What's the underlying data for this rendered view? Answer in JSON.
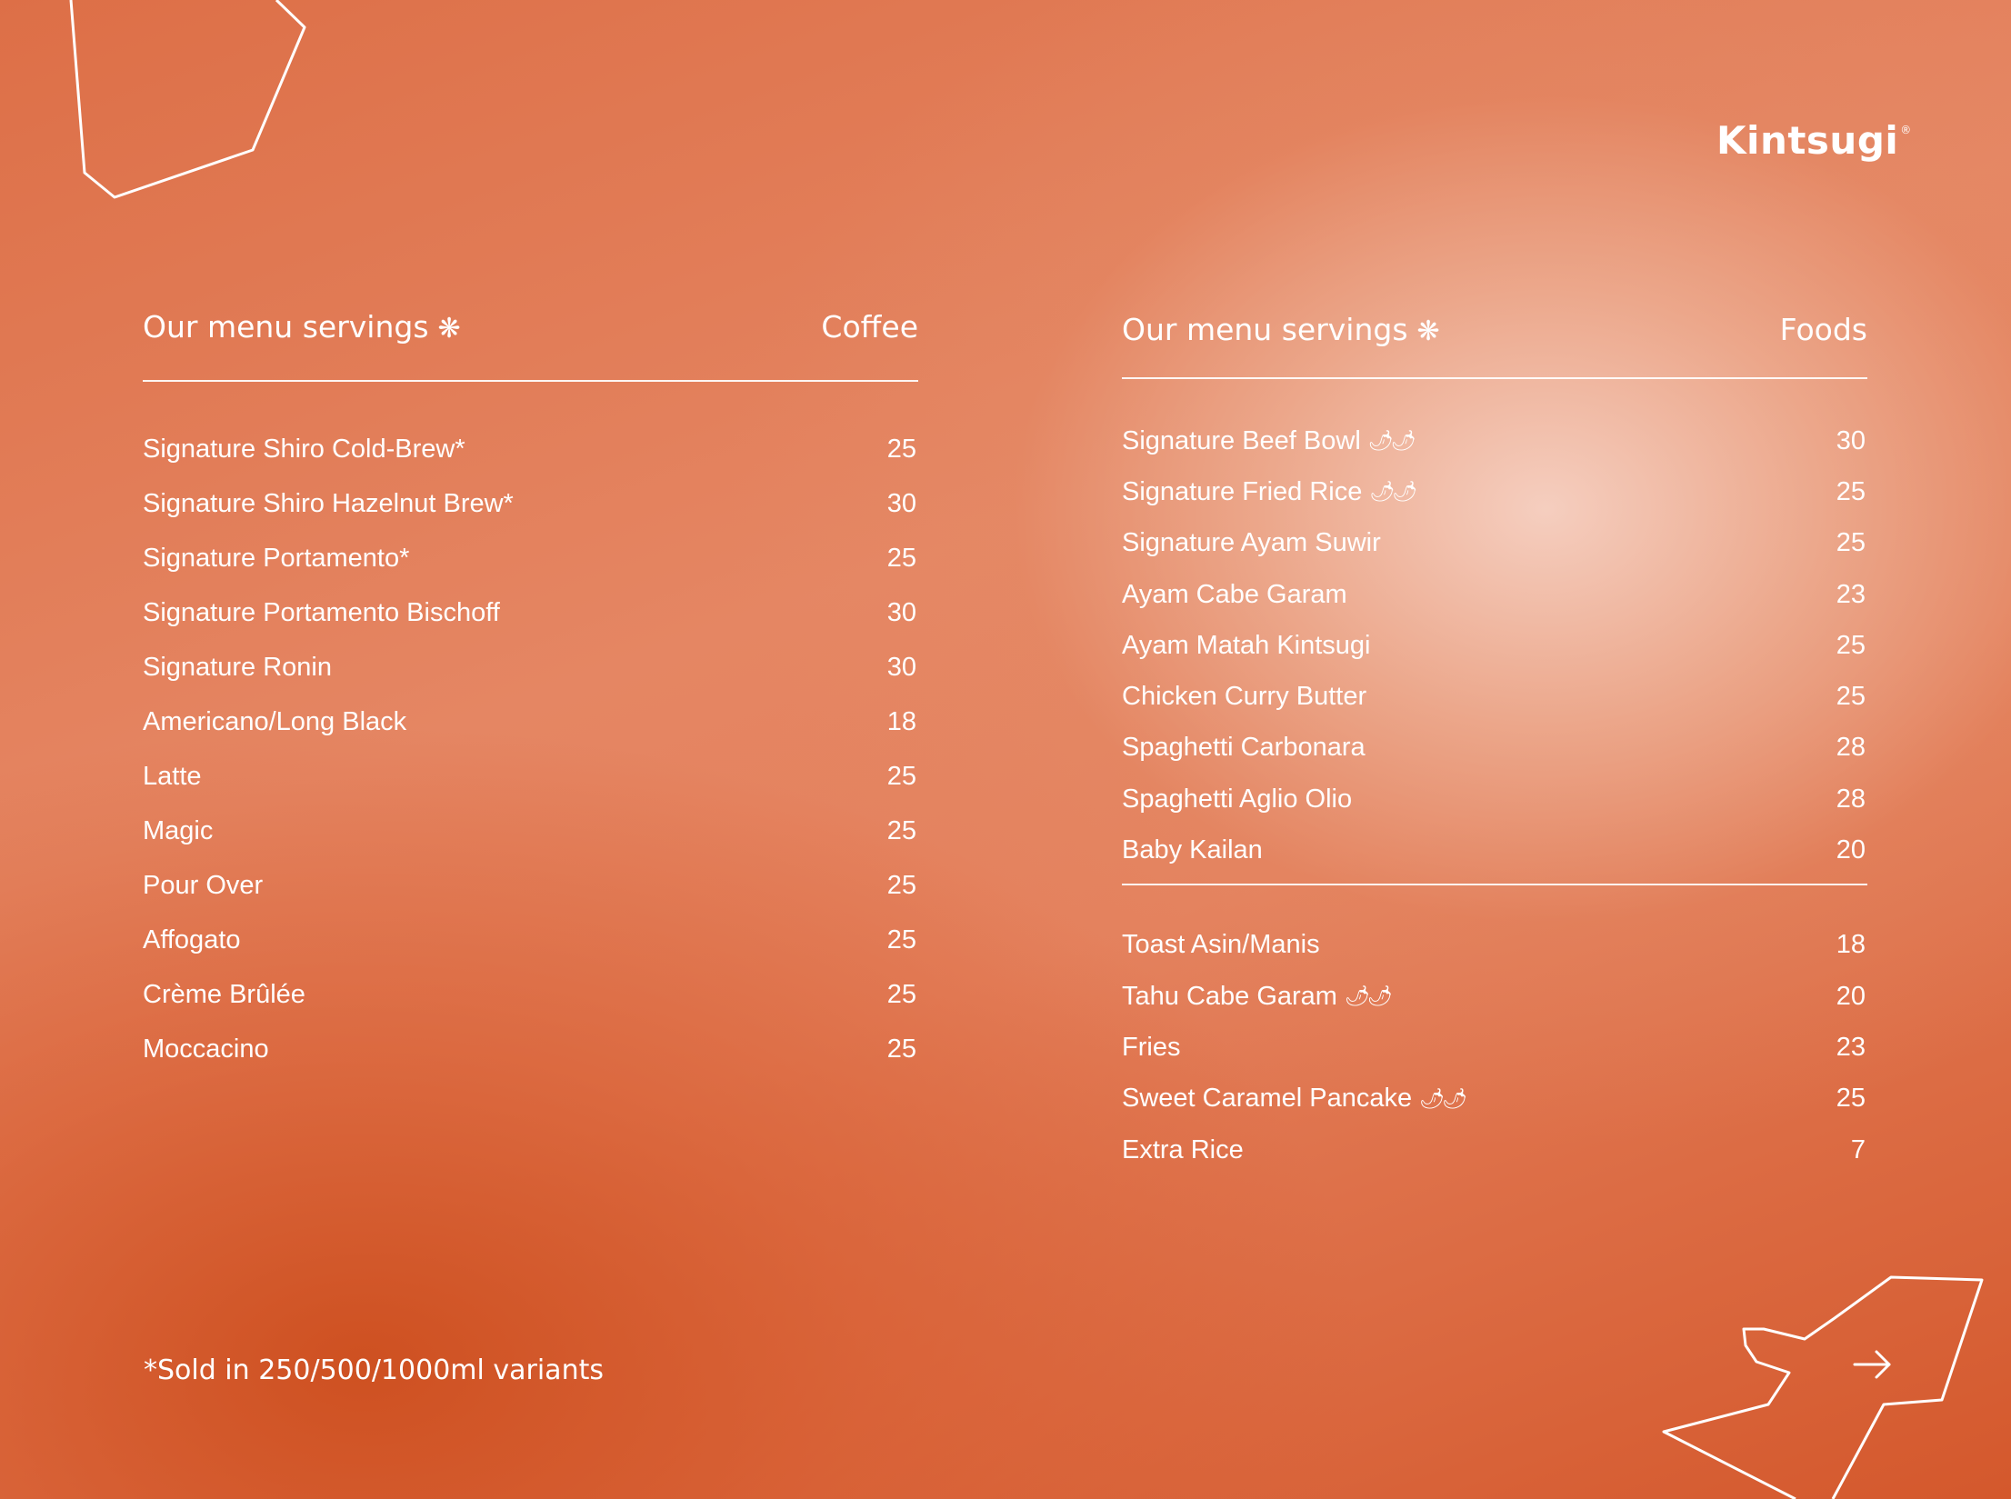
{
  "brand": {
    "logo_text": "Kintsugi",
    "mark": "®"
  },
  "coffee": {
    "heading": "Our menu servings",
    "heading_icon": "❋",
    "category": "Coffee",
    "items": [
      {
        "name": "Signature Shiro Cold-Brew*",
        "price": "25"
      },
      {
        "name": "Signature Shiro Hazelnut Brew*",
        "price": "30"
      },
      {
        "name": "Signature Portamento*",
        "price": "25"
      },
      {
        "name": "Signature Portamento Bischoff",
        "price": "30"
      },
      {
        "name": "Signature Ronin",
        "price": "30"
      },
      {
        "name": "Americano/Long Black",
        "price": "18"
      },
      {
        "name": "Latte",
        "price": "25"
      },
      {
        "name": "Magic",
        "price": "25"
      },
      {
        "name": "Pour Over",
        "price": "25"
      },
      {
        "name": "Affogato",
        "price": "25"
      },
      {
        "name": "Crème Brûlée",
        "price": "25"
      },
      {
        "name": "Moccacino",
        "price": "25"
      }
    ]
  },
  "foods": {
    "heading": "Our menu servings",
    "heading_icon": "❋",
    "category": "Foods",
    "mains": [
      {
        "name": "Signature Beef Bowl",
        "price": "30",
        "spicy": true
      },
      {
        "name": "Signature Fried Rice",
        "price": "25",
        "spicy": true
      },
      {
        "name": "Signature Ayam Suwir",
        "price": "25",
        "spicy": false
      },
      {
        "name": "Ayam Cabe Garam",
        "price": "23",
        "spicy": false
      },
      {
        "name": "Ayam Matah Kintsugi",
        "price": "25",
        "spicy": false
      },
      {
        "name": "Chicken Curry Butter",
        "price": "25",
        "spicy": false
      },
      {
        "name": "Spaghetti Carbonara",
        "price": "28",
        "spicy": false
      },
      {
        "name": "Spaghetti Aglio Olio",
        "price": "28",
        "spicy": false
      },
      {
        "name": "Baby Kailan",
        "price": "20",
        "spicy": false
      }
    ],
    "sides": [
      {
        "name": "Toast  Asin/Manis",
        "price": "18",
        "spicy": false
      },
      {
        "name": "Tahu Cabe Garam",
        "price": "20",
        "spicy": true
      },
      {
        "name": "Fries",
        "price": "23",
        "spicy": false
      },
      {
        "name": "Sweet Caramel Pancake",
        "price": "25",
        "spicy": true
      },
      {
        "name": "Extra Rice",
        "price": "7",
        "spicy": false
      }
    ]
  },
  "footnote": "*Sold in 250/500/1000ml variants",
  "icons": {
    "spicy": "chili-icon",
    "next": "arrow-right-icon",
    "decor_top": "polygon-outline-icon",
    "decor_bottom": "bird-outline-icon"
  }
}
